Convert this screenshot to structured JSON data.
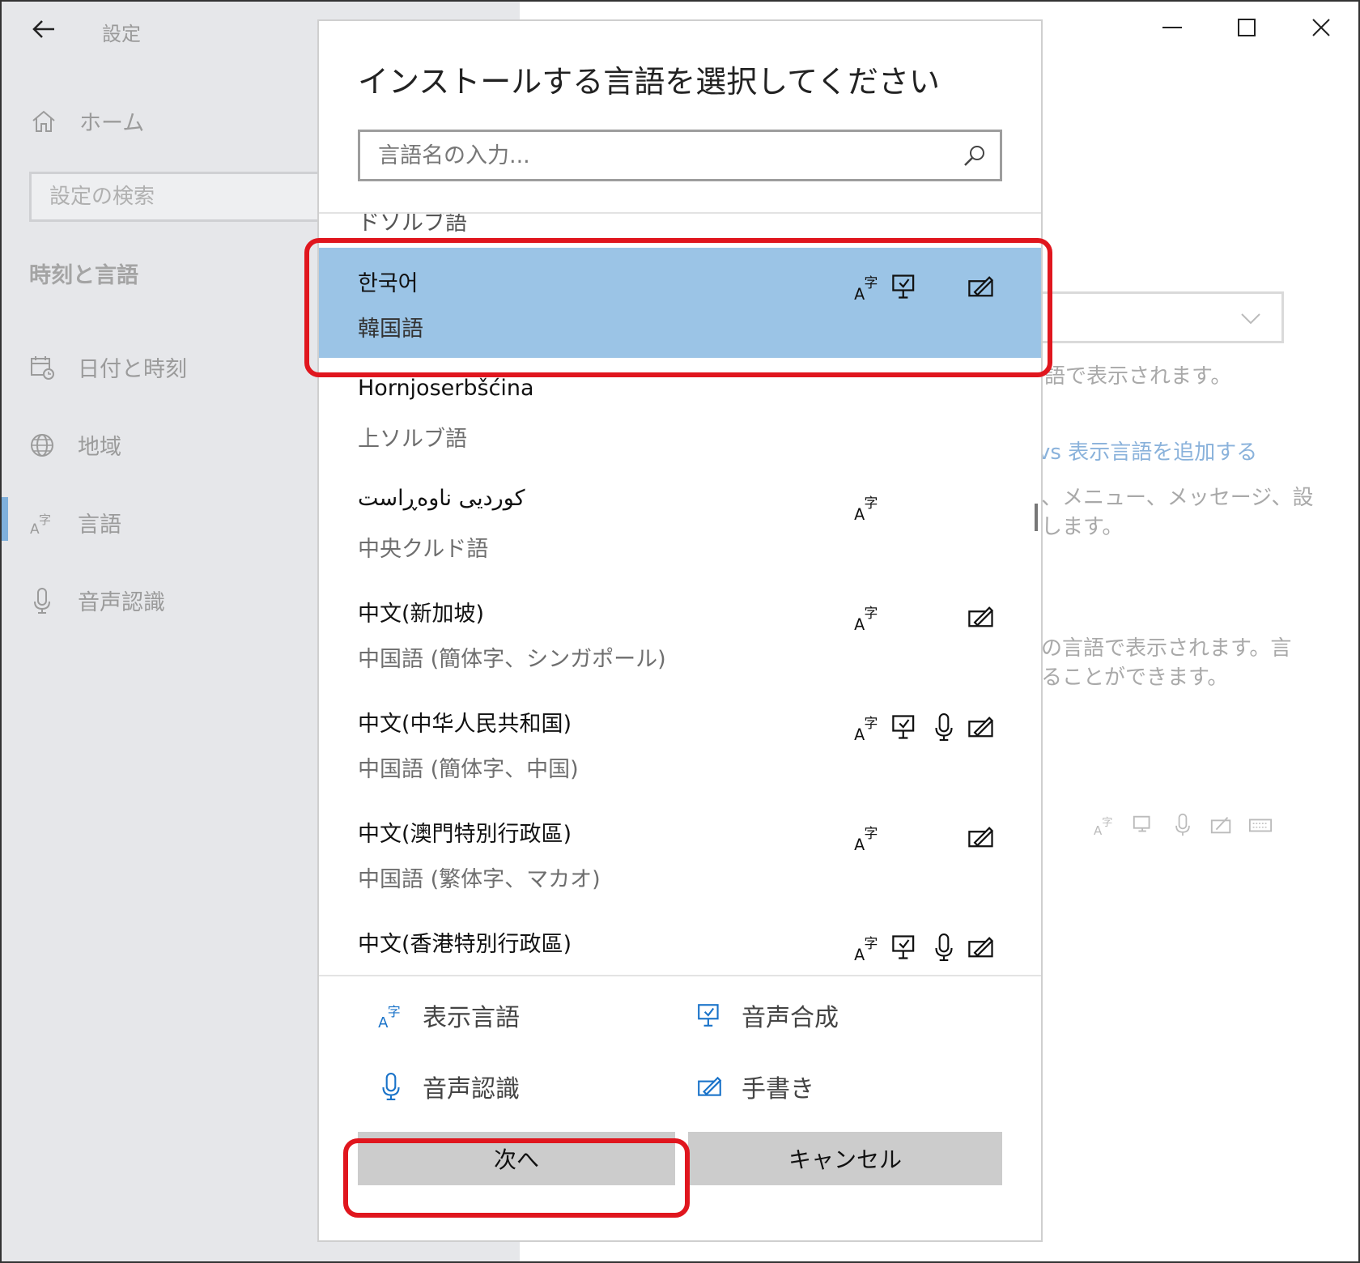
{
  "window": {
    "app_title": "設定",
    "icons": {
      "back": "back-arrow-icon",
      "minimize": "minimize-icon",
      "maximize": "maximize-icon",
      "close": "close-icon"
    }
  },
  "sidebar": {
    "home_label": "ホーム",
    "search_placeholder": "設定の検索",
    "section_heading": "時刻と言語",
    "items": [
      {
        "label": "日付と時刻",
        "icon": "calendar-clock-icon"
      },
      {
        "label": "地域",
        "icon": "globe-icon"
      },
      {
        "label": "言語",
        "icon": "language-icon",
        "active": true
      },
      {
        "label": "音声認識",
        "icon": "microphone-icon"
      }
    ]
  },
  "background": {
    "text1": "語で表示されます。",
    "link": "vs 表示言語を追加する",
    "text2a": "、メニュー、メッセージ、設",
    "text2b": "します。",
    "text3a": "の言語で表示されます。言",
    "text3b": "ることができます。"
  },
  "dialog": {
    "title": "インストールする言語を選択してください",
    "search_placeholder": "言語名の入力...",
    "partial_top": "ドソルブ語",
    "languages": [
      {
        "native": "한국어",
        "jp": "韓国語",
        "selected": true,
        "features": {
          "display": true,
          "tts": true,
          "speech": false,
          "handwriting": true
        }
      },
      {
        "native": "Hornjoserbšćina",
        "jp": "上ソルブ語",
        "features": {
          "display": false,
          "tts": false,
          "speech": false,
          "handwriting": false
        }
      },
      {
        "native": "کوردیی ناوەڕاست",
        "jp": "中央クルド語",
        "features": {
          "display": true,
          "tts": false,
          "speech": false,
          "handwriting": false
        }
      },
      {
        "native": "中文(新加坡)",
        "jp": "中国語 (簡体字、シンガポール)",
        "features": {
          "display": true,
          "tts": false,
          "speech": false,
          "handwriting": true
        }
      },
      {
        "native": "中文(中华人民共和国)",
        "jp": "中国語 (簡体字、中国)",
        "features": {
          "display": true,
          "tts": true,
          "speech": true,
          "handwriting": true
        }
      },
      {
        "native": "中文(澳門特別行政區)",
        "jp": "中国語 (繁体字、マカオ)",
        "features": {
          "display": true,
          "tts": false,
          "speech": false,
          "handwriting": true
        }
      },
      {
        "native": "中文(香港特別行政區)",
        "jp": "",
        "features": {
          "display": true,
          "tts": true,
          "speech": true,
          "handwriting": true
        }
      }
    ],
    "legend": {
      "display": "表示言語",
      "tts": "音声合成",
      "speech": "音声認識",
      "handwriting": "手書き"
    },
    "next_label": "次へ",
    "cancel_label": "キャンセル"
  },
  "colors": {
    "selected_row": "#9bc4e6",
    "accent_icon": "#1a73c9",
    "highlight": "#e0161e"
  }
}
